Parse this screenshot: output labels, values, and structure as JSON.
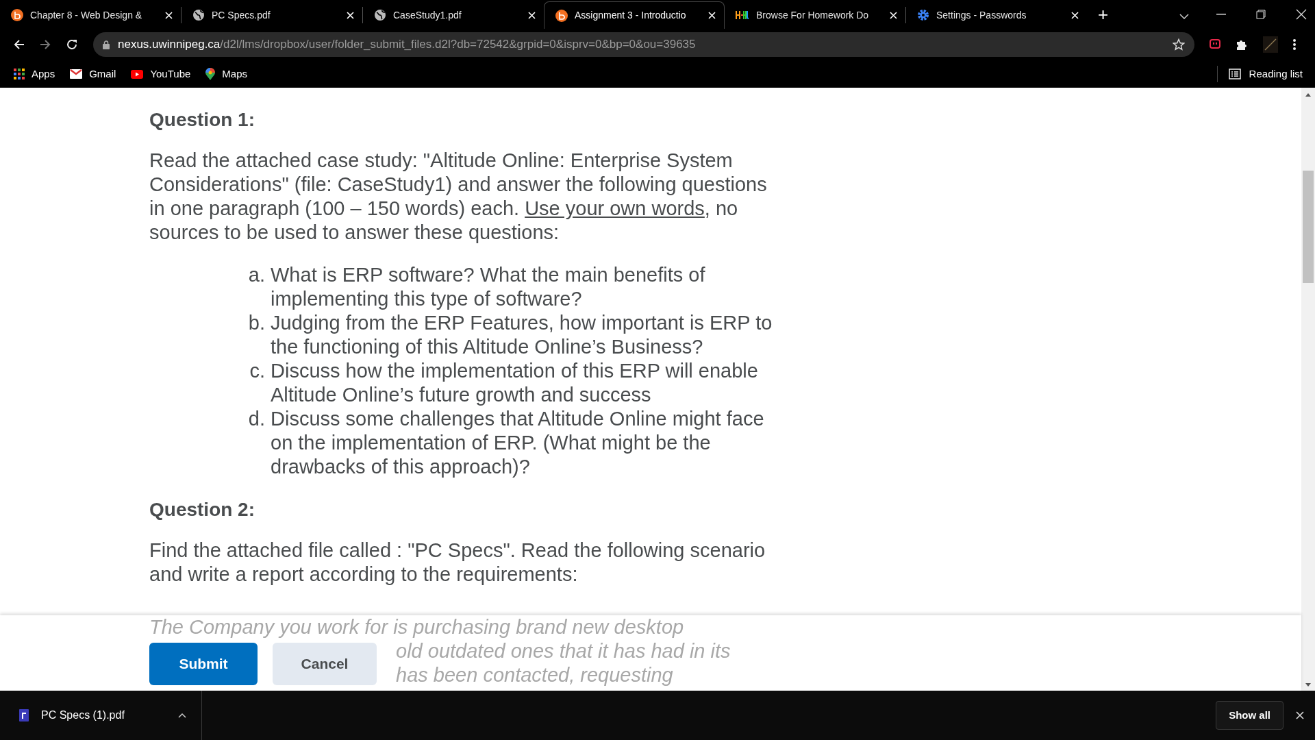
{
  "tabs": [
    {
      "title": "Chapter 8 - Web Design &",
      "kind": "brightspace",
      "selected": false
    },
    {
      "title": "PC Specs.pdf",
      "kind": "web",
      "selected": false
    },
    {
      "title": "CaseStudy1.pdf",
      "kind": "web",
      "selected": false
    },
    {
      "title": "Assignment 3 - Introductio",
      "kind": "brightspace",
      "selected": true
    },
    {
      "title": "Browse For Homework Do",
      "kind": "homework",
      "selected": false
    },
    {
      "title": "Settings - Passwords",
      "kind": "settings",
      "selected": false
    }
  ],
  "new_tab": "+",
  "address_bar": {
    "domain": "nexus.uwinnipeg.ca",
    "path": "/d2l/lms/dropbox/user/folder_submit_files.d2l?db=72542&grpid=0&isprv=0&bp=0&ou=39635"
  },
  "bookmarks": [
    {
      "label": "Apps",
      "kind": "apps"
    },
    {
      "label": "Gmail",
      "kind": "mail"
    },
    {
      "label": "YouTube",
      "kind": "video"
    },
    {
      "label": "Maps",
      "kind": "map"
    }
  ],
  "reading_list": "Reading list",
  "sections": [
    {
      "heading": "Question 1:",
      "paragraph": [
        {
          "kind": "text",
          "text": "Read the attached case study: \"Altitude Online: Enterprise System Considerations\" (file: CaseStudy1) and answer the following questions in one paragraph (100 – 150 words) each. "
        },
        {
          "kind": "link",
          "text": "Use your own words"
        },
        {
          "kind": "text",
          "text": ", no sources to be used to answer these questions:"
        }
      ],
      "items": [
        {
          "marker": "a.",
          "text": "What is ERP software? What the main benefits of implementing this type of software?"
        },
        {
          "marker": "b.",
          "text": "Judging from the ERP Features, how important is ERP to the functioning of this Altitude Online’s Business?"
        },
        {
          "marker": "c.",
          "text": "Discuss how the implementation of this ERP will enable Altitude Online’s future growth and success"
        },
        {
          "marker": "d.",
          "text": "Discuss some challenges that Altitude Online might face on the implementation of ERP. (What might be the drawbacks of this approach)?"
        }
      ]
    },
    {
      "heading": "Question 2:",
      "paragraph": [
        {
          "kind": "text",
          "text": "Find the attached file called : \"PC Specs\". Read the following scenario and write a report according to the requirements:"
        }
      ]
    }
  ],
  "faded_text": [
    "The Company you work for is purchasing brand new desktop",
    "old outdated ones that it has had in its",
    "has been contacted, requesting"
  ],
  "buttons": [
    {
      "label": "Submit",
      "kind": "primary"
    },
    {
      "label": "Cancel",
      "kind": "secondary"
    }
  ],
  "download": {
    "file": "PC Specs (1).pdf",
    "show_all": "Show all"
  }
}
